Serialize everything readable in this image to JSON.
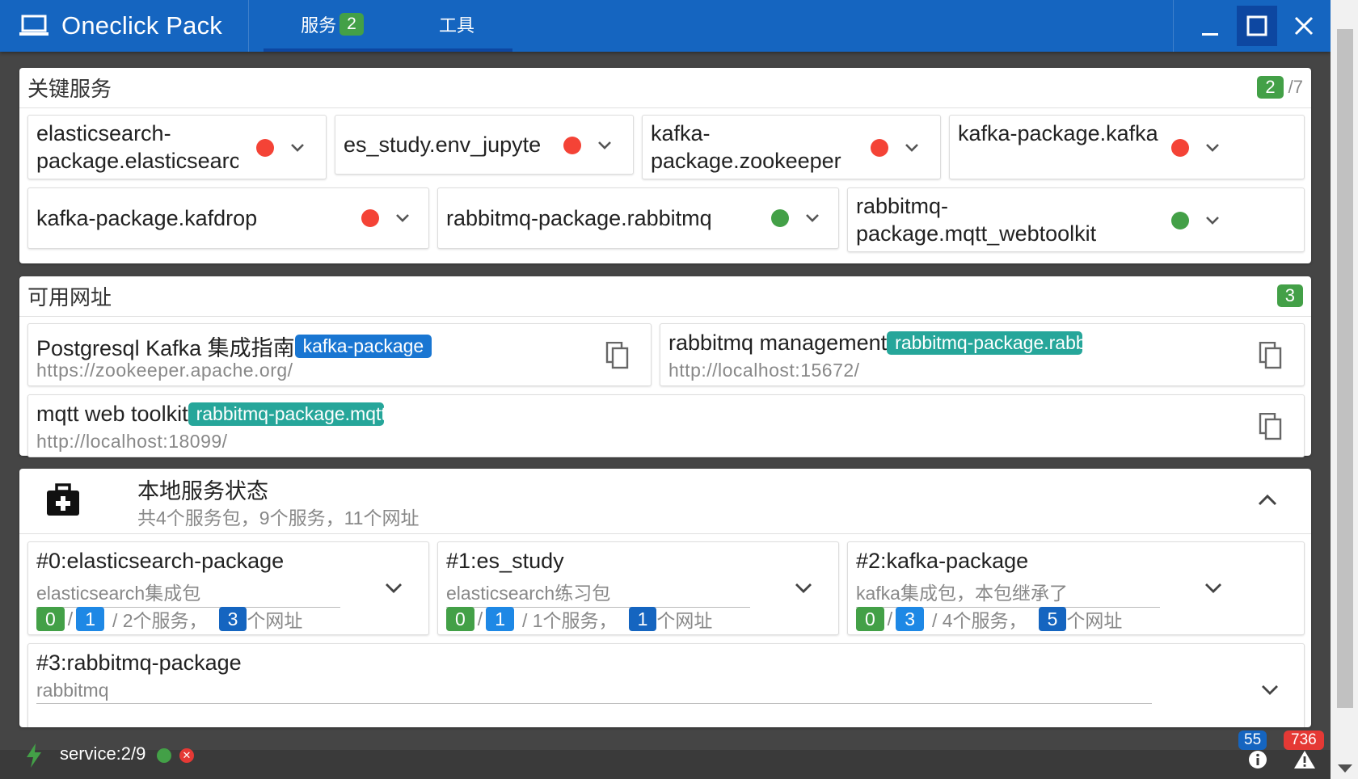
{
  "app": {
    "title": "Oneclick Pack",
    "icon": "laptop-icon"
  },
  "tabs": [
    {
      "label": "服务",
      "badge": "2"
    },
    {
      "label": "工具"
    }
  ],
  "window_controls": {
    "minimize": "minimize-icon",
    "maximize": "maximize-icon",
    "close": "close-icon"
  },
  "key_services": {
    "title": "关键服务",
    "running": "2",
    "total": "/7",
    "items": [
      {
        "name": "elasticsearch-package.elasticsearch",
        "status": "stopped"
      },
      {
        "name": "es_study.env_jupyter",
        "status": "stopped"
      },
      {
        "name": "kafka-package.zookeeper",
        "status": "stopped"
      },
      {
        "name": "kafka-package.kafka",
        "status": "stopped"
      },
      {
        "name": "kafka-package.kafdrop",
        "status": "stopped"
      },
      {
        "name": "rabbitmq-package.rabbitmq",
        "status": "running"
      },
      {
        "name": "rabbitmq-package.mqtt_webtoolkit",
        "status": "running"
      }
    ]
  },
  "urls": {
    "title": "可用网址",
    "count": "3",
    "items": [
      {
        "title": "Postgresql Kafka 集成指南",
        "tag": "kafka-package",
        "url": "https://zookeeper.apache.org/"
      },
      {
        "title": "rabbitmq management",
        "tag": "rabbitmq-package.rabbitmq",
        "url": "http://localhost:15672/"
      },
      {
        "title": "mqtt web toolkit",
        "tag": "rabbitmq-package.mqtt_webtoolkit",
        "url": "http://localhost:18099/"
      }
    ]
  },
  "local_status": {
    "title": "本地服务状态",
    "subtitle": "共4个服务包，9个服务，11个网址",
    "packages": [
      {
        "name": "#0:elasticsearch-package",
        "desc": "elasticsearch集成包",
        "running": "0",
        "stopped": "1",
        "services": "/ 2个服务，",
        "urls": "3",
        "urls_label": "个网址"
      },
      {
        "name": "#1:es_study",
        "desc": "elasticsearch练习包",
        "running": "0",
        "stopped": "1",
        "services": "/ 1个服务，",
        "urls": "1",
        "urls_label": "个网址"
      },
      {
        "name": "#2:kafka-package",
        "desc": "kafka集成包，本包继承了",
        "running": "0",
        "stopped": "3",
        "services": "/ 4个服务，",
        "urls": "5",
        "urls_label": "个网址"
      },
      {
        "name": "#3:rabbitmq-package",
        "desc": "rabbitmq"
      }
    ]
  },
  "statusbar": {
    "service_text": "service:2/9",
    "info_count": "55",
    "warn_count": "736"
  },
  "colors": {
    "primary": "#1565c0",
    "running": "#43a047",
    "stopped": "#f44336",
    "teal_tag": "#26a69a",
    "blue_tag": "#1976d2"
  }
}
